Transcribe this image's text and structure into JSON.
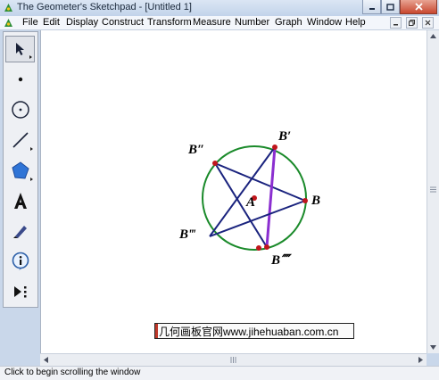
{
  "window": {
    "title": "The Geometer's Sketchpad - [Untitled 1]"
  },
  "menu": {
    "items": [
      "File",
      "Edit",
      "Display",
      "Construct",
      "Transform",
      "Measure",
      "Number",
      "Graph",
      "Window",
      "Help"
    ]
  },
  "toolbox": {
    "tools": [
      "arrow-select-tool",
      "point-tool",
      "compass-tool",
      "straightedge-tool",
      "polygon-tool",
      "text-tool",
      "marker-tool",
      "information-tool",
      "custom-tool"
    ]
  },
  "sketch": {
    "labels": {
      "A": "A",
      "B": "B",
      "B1": "B′",
      "B2": "B″",
      "B3": "B‴",
      "B4": "B⁗"
    },
    "colors": {
      "circle": "#1a8a2a",
      "star": "#1a237e",
      "highlighted_segment": "#8b2fd0",
      "points": "#c0161c"
    }
  },
  "watermark": {
    "text": "几何画板官网www.jihehuaban.com.cn"
  },
  "status": {
    "text": "Click to begin scrolling the window"
  },
  "colors": {
    "titlebar": "#c9d7ea",
    "close_button": "#c8472f"
  }
}
